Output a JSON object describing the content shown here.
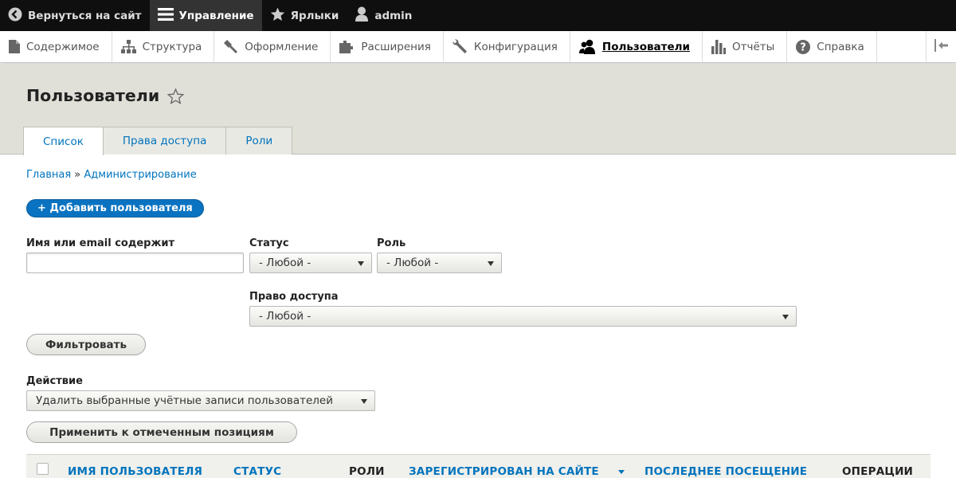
{
  "toolbar": {
    "back_label": "Вернуться на сайт",
    "manage_label": "Управление",
    "shortcuts_label": "Ярлыки",
    "user_label": "admin"
  },
  "tray": {
    "items": [
      {
        "label": "Содержимое",
        "icon": "file-icon"
      },
      {
        "label": "Структура",
        "icon": "sitemap-icon"
      },
      {
        "label": "Оформление",
        "icon": "paintbrush-icon"
      },
      {
        "label": "Расширения",
        "icon": "puzzle-icon"
      },
      {
        "label": "Конфигурация",
        "icon": "wrench-icon"
      },
      {
        "label": "Пользователи",
        "icon": "people-icon"
      },
      {
        "label": "Отчёты",
        "icon": "bar-chart-icon"
      },
      {
        "label": "Справка",
        "icon": "help-icon"
      }
    ]
  },
  "page": {
    "title": "Пользователи"
  },
  "tabs": [
    "Список",
    "Права доступа",
    "Роли"
  ],
  "breadcrumb": {
    "home": "Главная",
    "separator": "»",
    "admin": "Администрирование"
  },
  "add_user_label": "+ Добавить пользователя",
  "filters": {
    "name_label": "Имя или email содержит",
    "name_value": "",
    "status_label": "Статус",
    "status_value": "- Любой -",
    "role_label": "Роль",
    "role_value": "- Любой -",
    "permission_label": "Право доступа",
    "permission_value": "- Любой -",
    "filter_button": "Фильтровать"
  },
  "action": {
    "label": "Действие",
    "value": "Удалить выбранные учётные записи пользователей",
    "apply_button": "Применить к отмеченным позициям"
  },
  "table": {
    "headers": [
      {
        "label": "ИМЯ ПОЛЬЗОВАТЕЛЯ",
        "link": true
      },
      {
        "label": "СТАТУС",
        "link": true
      },
      {
        "label": "РОЛИ",
        "link": false
      },
      {
        "label": "ЗАРЕГИСТРИРОВАН НА САЙТЕ",
        "link": true
      },
      {
        "label": "ПОСЛЕДНЕЕ ПОСЕЩЕНИЕ",
        "link": true
      },
      {
        "label": "ОПЕРАЦИИ",
        "link": false
      }
    ]
  },
  "colors": {
    "link": "#0074bd",
    "primary_button": "#0a73c1",
    "toolbar_bg": "#0f0f0f",
    "header_bg": "#e0e0d8"
  }
}
